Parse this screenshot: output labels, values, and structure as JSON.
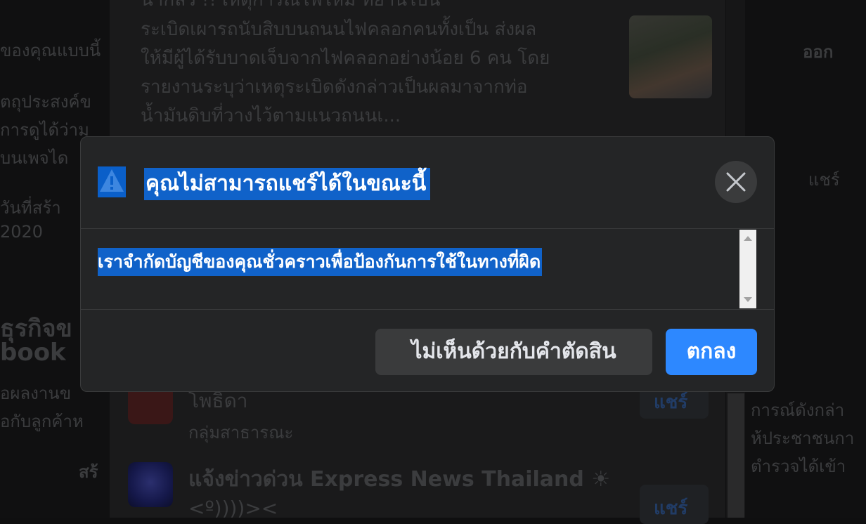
{
  "background": {
    "post_lines": [
      "น่ากลัว !! เหตุการณ์ไฟไหม้ ที่ย่านไบน์",
      "ระเบิดเผารถนับสิบบนถนนไฟคลอกคนทั้งเป็น ส่งผล",
      "ให้มีผู้ได้รับบาดเจ็บจากไฟคลอกอย่างน้อย 6 คน โดย",
      "รายงานระบุว่าเหตุระเบิดดังกล่าวเป็นผลมาจากท่อ",
      "น้ำมันดิบที่วางไว้ตามแนวถนนเ..."
    ],
    "left_column": [
      "ของคุณแบบนี้",
      "ัตถุประสงค์ข",
      "การดูได้ว่าม",
      "บนเพจได",
      "วันที่สร้า",
      "2020",
      "ธุรกิจข",
      "book",
      "อผลงานข",
      "อกับลูกค้าห",
      "สร้"
    ],
    "group1_name": "โพธิดา",
    "group1_type": "กลุ่มสาธารณะ",
    "group2_name": "แจ้งข่าวด่วน Express News Thailand ☀",
    "group2_subname": "<º))))><",
    "share_label": "แชร์",
    "right_column": [
      "ออก",
      "แชร์",
      "การณ์ดังกล่า",
      "ห้ประชาชนกา",
      "ตำรวจได้เข้า"
    ]
  },
  "modal": {
    "title": "คุณไม่สามารถแชร์ได้ในขณะนี้",
    "message": "เราจำกัดบัญชีของคุณชั่วคราวเพื่อป้องกันการใช้ในทางที่ผิด",
    "disagree_label": "ไม่เห็นด้วยกับคำตัดสิน",
    "ok_label": "ตกลง",
    "warning_icon": "warning-triangle-icon",
    "close_icon": "close-x-icon"
  },
  "colors": {
    "primary_button": "#2d88ff",
    "selection_highlight": "#1062c9",
    "modal_background": "#242526"
  }
}
